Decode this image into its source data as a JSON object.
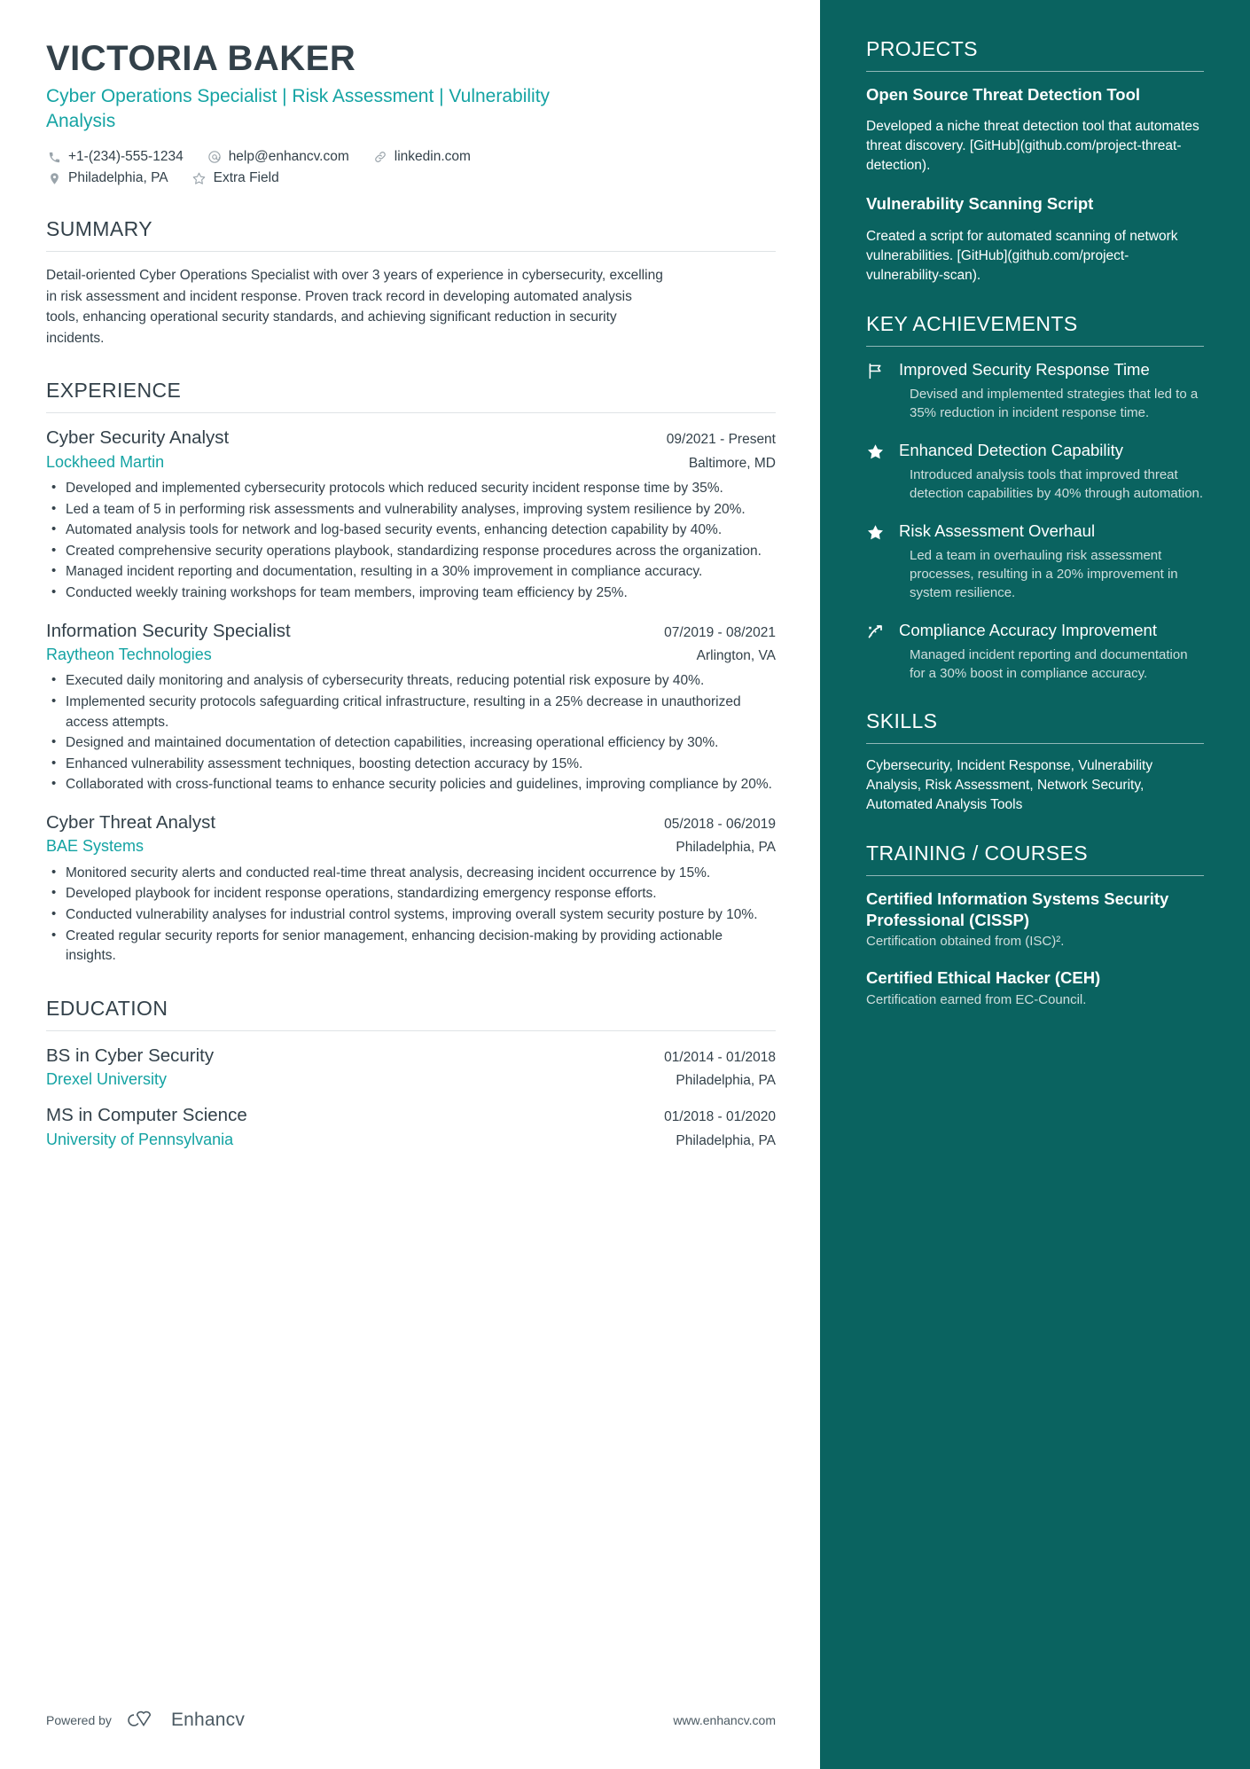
{
  "theme": {
    "accent_teal": "#14a3a3",
    "sidebar_bg": "#0a6360",
    "text_dark": "#33414a",
    "rule": "#dfe3e6"
  },
  "header": {
    "name": "VICTORIA BAKER",
    "headline": "Cyber Operations Specialist | Risk Assessment | Vulnerability Analysis",
    "contacts_row1": [
      {
        "icon": "phone-icon",
        "text": "+1-(234)-555-1234"
      },
      {
        "icon": "email-icon",
        "text": "help@enhancv.com"
      },
      {
        "icon": "link-icon",
        "text": "linkedin.com"
      }
    ],
    "contacts_row2": [
      {
        "icon": "location-icon",
        "text": "Philadelphia, PA"
      },
      {
        "icon": "star-icon",
        "text": "Extra Field"
      }
    ]
  },
  "summary": {
    "title": "SUMMARY",
    "text": "Detail-oriented Cyber Operations Specialist with over 3 years of experience in cybersecurity, excelling in risk assessment and incident response. Proven track record in developing automated analysis tools, enhancing operational security standards, and achieving significant reduction in security incidents."
  },
  "experience": {
    "title": "EXPERIENCE",
    "entries": [
      {
        "role": "Cyber Security Analyst",
        "date": "09/2021 - Present",
        "company": "Lockheed Martin",
        "location": "Baltimore, MD",
        "bullets": [
          "Developed and implemented cybersecurity protocols which reduced security incident response time by 35%.",
          "Led a team of 5 in performing risk assessments and vulnerability analyses, improving system resilience by 20%.",
          "Automated analysis tools for network and log-based security events, enhancing detection capability by 40%.",
          "Created comprehensive security operations playbook, standardizing response procedures across the organization.",
          "Managed incident reporting and documentation, resulting in a 30% improvement in compliance accuracy.",
          "Conducted weekly training workshops for team members, improving team efficiency by 25%."
        ]
      },
      {
        "role": "Information Security Specialist",
        "date": "07/2019 - 08/2021",
        "company": "Raytheon Technologies",
        "location": "Arlington, VA",
        "bullets": [
          "Executed daily monitoring and analysis of cybersecurity threats, reducing potential risk exposure by 40%.",
          "Implemented security protocols safeguarding critical infrastructure, resulting in a 25% decrease in unauthorized access attempts.",
          "Designed and maintained documentation of detection capabilities, increasing operational efficiency by 30%.",
          "Enhanced vulnerability assessment techniques, boosting detection accuracy by 15%.",
          "Collaborated with cross-functional teams to enhance security policies and guidelines, improving compliance by 20%."
        ]
      },
      {
        "role": "Cyber Threat Analyst",
        "date": "05/2018 - 06/2019",
        "company": "BAE Systems",
        "location": "Philadelphia, PA",
        "bullets": [
          "Monitored security alerts and conducted real-time threat analysis, decreasing incident occurrence by 15%.",
          "Developed playbook for incident response operations, standardizing emergency response efforts.",
          "Conducted vulnerability analyses for industrial control systems, improving overall system security posture by 10%.",
          "Created regular security reports for senior management, enhancing decision-making by providing actionable insights."
        ]
      }
    ]
  },
  "education": {
    "title": "EDUCATION",
    "entries": [
      {
        "degree": "BS in Cyber Security",
        "date": "01/2014 - 01/2018",
        "school": "Drexel University",
        "location": "Philadelphia, PA"
      },
      {
        "degree": "MS in Computer Science",
        "date": "01/2018 - 01/2020",
        "school": "University of Pennsylvania",
        "location": "Philadelphia, PA"
      }
    ]
  },
  "projects": {
    "title": "PROJECTS",
    "items": [
      {
        "name": "Open Source Threat Detection Tool",
        "description": "Developed a niche threat detection tool that automates threat discovery. [GitHub](github.com/project-threat-detection)."
      },
      {
        "name": "Vulnerability Scanning Script",
        "description": "Created a script for automated scanning of network vulnerabilities. [GitHub](github.com/project-vulnerability-scan)."
      }
    ]
  },
  "achievements": {
    "title": "KEY ACHIEVEMENTS",
    "items": [
      {
        "icon": "flag-icon",
        "title": "Improved Security Response Time",
        "description": "Devised and implemented strategies that led to a 35% reduction in incident response time."
      },
      {
        "icon": "star-filled-icon",
        "title": "Enhanced Detection Capability",
        "description": "Introduced analysis tools that improved threat detection capabilities by 40% through automation."
      },
      {
        "icon": "star-filled-icon",
        "title": "Risk Assessment Overhaul",
        "description": "Led a team in overhauling risk assessment processes, resulting in a 20% improvement in system resilience."
      },
      {
        "icon": "trending-up-icon",
        "title": "Compliance Accuracy Improvement",
        "description": "Managed incident reporting and documentation for a 30% boost in compliance accuracy."
      }
    ]
  },
  "skills": {
    "title": "SKILLS",
    "text": "Cybersecurity, Incident Response, Vulnerability Analysis, Risk Assessment, Network Security, Automated Analysis Tools"
  },
  "training": {
    "title": "TRAINING / COURSES",
    "items": [
      {
        "name": "Certified Information Systems Security Professional (CISSP)",
        "description": "Certification obtained from (ISC)²."
      },
      {
        "name": "Certified Ethical Hacker (CEH)",
        "description": "Certification earned from EC-Council."
      }
    ]
  },
  "footer": {
    "powered_by": "Powered by",
    "brand": "Enhancv",
    "website": "www.enhancv.com"
  }
}
